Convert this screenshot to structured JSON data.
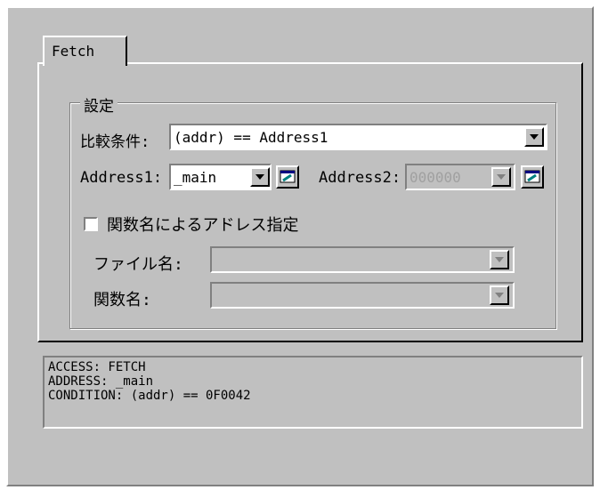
{
  "tab": {
    "label": "Fetch"
  },
  "group": {
    "title": "設定"
  },
  "condition": {
    "label": "比較条件:",
    "value": "(addr) == Address1"
  },
  "address1": {
    "label": "Address1:",
    "value": "_main"
  },
  "address2": {
    "label": "Address2:",
    "value": "000000"
  },
  "checkbox": {
    "label": "関数名によるアドレス指定",
    "checked": false
  },
  "file": {
    "label": "ファイル名:",
    "value": ""
  },
  "func": {
    "label": "関数名:",
    "value": ""
  },
  "output": {
    "lines": [
      "ACCESS: FETCH",
      "ADDRESS: _main",
      "CONDITION: (addr) == 0F0042"
    ]
  }
}
